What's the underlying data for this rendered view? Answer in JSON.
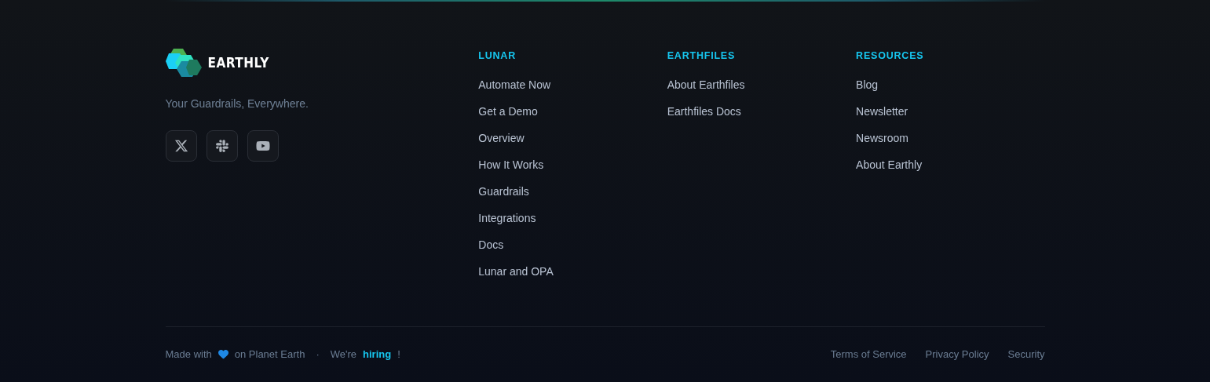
{
  "brand": {
    "name": "EARTHLY",
    "tagline": "Your Guardrails, Everywhere."
  },
  "social": [
    {
      "kind": "x"
    },
    {
      "kind": "slack"
    },
    {
      "kind": "youtube"
    }
  ],
  "columns": [
    {
      "title": "LUNAR",
      "links": [
        "Automate Now",
        "Get a Demo",
        "Overview",
        "How It Works",
        "Guardrails",
        "Integrations",
        "Docs",
        "Lunar and OPA"
      ]
    },
    {
      "title": "EARTHFILES",
      "links": [
        "About Earthfiles",
        "Earthfiles Docs"
      ]
    },
    {
      "title": "RESOURCES",
      "links": [
        "Blog",
        "Newsletter",
        "Newsroom",
        "About Earthly"
      ]
    }
  ],
  "bottom": {
    "made_with": "Made with",
    "on_planet": "on Planet Earth",
    "separator": "·",
    "were": "We're",
    "hiring": "hiring",
    "exclaim": "!",
    "legal": [
      "Terms of Service",
      "Privacy Policy",
      "Security"
    ]
  }
}
